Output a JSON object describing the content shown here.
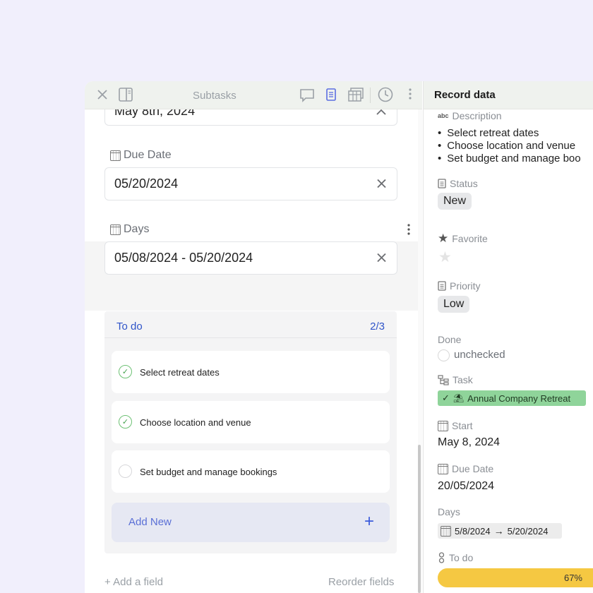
{
  "left_pane": {
    "toolbar": {
      "title": "Subtasks"
    },
    "fields": [
      {
        "label": "",
        "value": "May 8th, 2024"
      },
      {
        "label": "Due Date",
        "value": "05/20/2024"
      },
      {
        "label": "Days",
        "value": "05/08/2024 - 05/20/2024"
      }
    ],
    "todo": {
      "title": "To do",
      "count": "2/3",
      "items": [
        {
          "label": "Select retreat dates",
          "done": true
        },
        {
          "label": "Choose location and venue",
          "done": true
        },
        {
          "label": "Set budget and manage bookings",
          "done": false
        }
      ],
      "add_new_label": "Add New",
      "add_new_icon": "+"
    },
    "add_field_label": "Add a field",
    "reorder_fields_label": "Reorder fields"
  },
  "right_pane": {
    "title": "Record data",
    "description": {
      "icon_text": "abc",
      "label": "Description",
      "items": [
        "Select retreat dates",
        "Choose location and venue",
        "Set budget and manage boo"
      ]
    },
    "status": {
      "label": "Status",
      "value": "New"
    },
    "favorite": {
      "label": "Favorite"
    },
    "priority": {
      "label": "Priority",
      "value": "Low"
    },
    "done": {
      "label": "Done",
      "value": "unchecked"
    },
    "task": {
      "label": "Task",
      "value": "Annual Company Retreat"
    },
    "start": {
      "label": "Start",
      "value": "May 8, 2024"
    },
    "due_date": {
      "label": "Due Date",
      "value": "20/05/2024"
    },
    "days": {
      "label": "Days",
      "from": "5/8/2024",
      "to": "5/20/2024"
    },
    "todo": {
      "label": "To do",
      "progress_text": "67%",
      "progress_fraction": 0.67
    }
  },
  "colors": {
    "accent_blue": "#2f54c9",
    "task_chip": "#8fd49a",
    "progress": "#f5c842",
    "check_green": "#45a24f"
  }
}
